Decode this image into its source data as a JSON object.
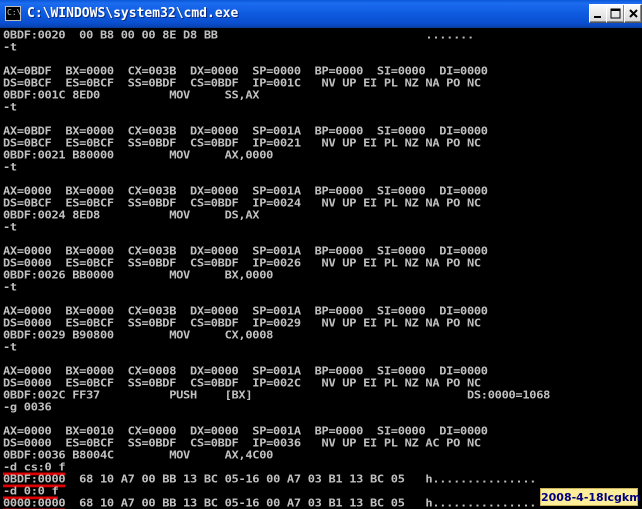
{
  "window": {
    "title": "C:\\WINDOWS\\system32\\cmd.exe",
    "icon": "console-icon",
    "controls": {
      "minimize": "minimize-icon",
      "maximize": "maximize-icon",
      "close": "close-icon"
    }
  },
  "console": {
    "lines": [
      "0BDF:0020  00 B8 00 00 8E D8 BB                              .......",
      "-t",
      "",
      "AX=0BDF  BX=0000  CX=003B  DX=0000  SP=0000  BP=0000  SI=0000  DI=0000",
      "DS=0BCF  ES=0BCF  SS=0BDF  CS=0BDF  IP=001C   NV UP EI PL NZ NA PO NC",
      "0BDF:001C 8ED0          MOV     SS,AX",
      "-t",
      "",
      "AX=0BDF  BX=0000  CX=003B  DX=0000  SP=001A  BP=0000  SI=0000  DI=0000",
      "DS=0BCF  ES=0BCF  SS=0BDF  CS=0BDF  IP=0021   NV UP EI PL NZ NA PO NC",
      "0BDF:0021 B80000        MOV     AX,0000",
      "-t",
      "",
      "AX=0000  BX=0000  CX=003B  DX=0000  SP=001A  BP=0000  SI=0000  DI=0000",
      "DS=0BCF  ES=0BCF  SS=0BDF  CS=0BDF  IP=0024   NV UP EI PL NZ NA PO NC",
      "0BDF:0024 8ED8          MOV     DS,AX",
      "-t",
      "",
      "AX=0000  BX=0000  CX=003B  DX=0000  SP=001A  BP=0000  SI=0000  DI=0000",
      "DS=0000  ES=0BCF  SS=0BDF  CS=0BDF  IP=0026   NV UP EI PL NZ NA PO NC",
      "0BDF:0026 BB0000        MOV     BX,0000",
      "-t",
      "",
      "AX=0000  BX=0000  CX=003B  DX=0000  SP=001A  BP=0000  SI=0000  DI=0000",
      "DS=0000  ES=0BCF  SS=0BDF  CS=0BDF  IP=0029   NV UP EI PL NZ NA PO NC",
      "0BDF:0029 B90800        MOV     CX,0008",
      "-t",
      "",
      "AX=0000  BX=0000  CX=0008  DX=0000  SP=001A  BP=0000  SI=0000  DI=0000",
      "DS=0000  ES=0BCF  SS=0BDF  CS=0BDF  IP=002C   NV UP EI PL NZ NA PO NC",
      "0BDF:002C FF37          PUSH    [BX]                               DS:0000=1068",
      "-g 0036",
      "",
      "AX=0000  BX=0010  CX=0000  DX=0000  SP=001A  BP=0000  SI=0000  DI=0000",
      "DS=0000  ES=0BCF  SS=0BDF  CS=0BDF  IP=0036   NV UP EI PL NZ AC PO NC",
      "0BDF:0036 B8004C        MOV     AX,4C00",
      "-d cs:0 f",
      "0BDF:0000  68 10 A7 00 BB 13 BC 05-16 00 A7 03 B1 13 BC 05   h...............",
      "-d 0:0 f",
      "0000:0000  68 10 A7 00 BB 13 BC 05-16 00 A7 03 B1 13 BC 05   h..............."
    ],
    "highlighted": [
      36,
      37,
      38,
      39
    ]
  },
  "watermark": "2008-4-18lcgkm",
  "colors": {
    "titlebar": "#0a58d8",
    "console_bg": "#000000",
    "console_text": "#c0c0c0",
    "highlight_underline": "#e00000",
    "watermark_bg": "#ffee99",
    "watermark_text": "#000080"
  }
}
